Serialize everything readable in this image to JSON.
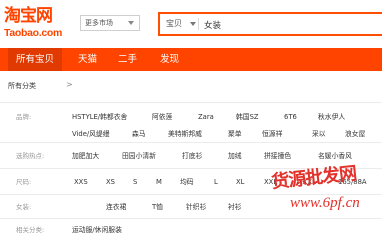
{
  "header": {
    "logo_text": "淘宝网",
    "logo_domain": "Taobao.com",
    "market_dropdown": "更多市场",
    "search_scope": "宝贝",
    "search_query": "女装"
  },
  "nav": {
    "tabs": [
      "所有宝贝",
      "天猫",
      "二手",
      "发现"
    ],
    "active_tab": "所有宝贝"
  },
  "breadcrumb": {
    "label": "所有分类",
    "caret": ">"
  },
  "filters": {
    "brand": {
      "label": "品牌:",
      "row1": [
        "HSTYLE/韩都衣舍",
        "阿依莲",
        "Zara",
        "韩国SZ",
        "6T6",
        "秋水伊人"
      ],
      "row2": [
        "Vide/风缇缦",
        "森马",
        "美特斯邦威",
        "聚单",
        "恒源祥",
        "采以",
        "浪女屋"
      ]
    },
    "hot": {
      "label": "选购热点:",
      "options": [
        "加肥加大",
        "田园小清新",
        "打底衫",
        "加绒",
        "拼接撞色",
        "名媛小香风"
      ]
    },
    "size": {
      "label": "尺码:",
      "options": [
        "XXS",
        "XS",
        "S",
        "M",
        "均码",
        "L",
        "XL",
        "XXL",
        "XXXL",
        "165/88A"
      ]
    },
    "women": {
      "label": "女装:",
      "options": [
        "连衣裙",
        "T恤",
        "针织衫",
        "衬衫"
      ]
    },
    "related": {
      "label": "相关分类:",
      "options": [
        "运动服/休闲服装"
      ]
    }
  },
  "watermark": {
    "text": "货源批发网",
    "url": "www.6pf.cn"
  },
  "colors": {
    "brand_orange": "#ff4400",
    "nav_active": "#e03a00",
    "watermark_red": "#e2322b"
  }
}
